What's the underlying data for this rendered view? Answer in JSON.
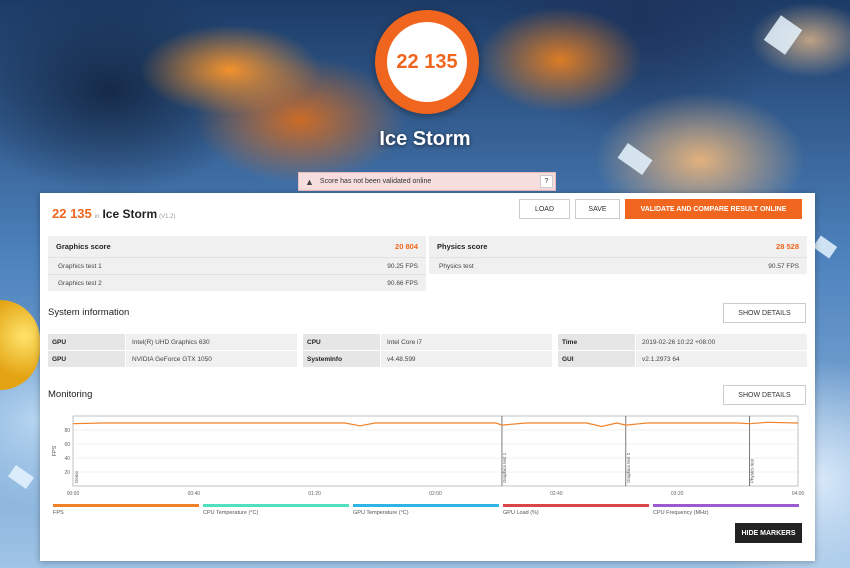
{
  "score": "22 135",
  "test_name": "Ice Storm",
  "warning": {
    "text": "Score has not been validated online",
    "help": "?"
  },
  "header": {
    "score": "22 135",
    "in": "in",
    "test_name": "Ice Storm",
    "version": "(V1.2)"
  },
  "buttons": {
    "load": "LOAD",
    "save": "SAVE",
    "validate": "VALIDATE AND COMPARE RESULT ONLINE",
    "show_details_system": "SHOW DETAILS",
    "show_details_monitoring": "SHOW DETAILS",
    "hide_markers": "HIDE MARKERS"
  },
  "graphics": {
    "label": "Graphics score",
    "value": "20 804",
    "tests": [
      {
        "name": "Graphics test 1",
        "value": "90.25 FPS"
      },
      {
        "name": "Graphics test 2",
        "value": "90.66 FPS"
      }
    ]
  },
  "physics": {
    "label": "Physics score",
    "value": "28 528",
    "tests": [
      {
        "name": "Physics test",
        "value": "90.57 FPS"
      }
    ]
  },
  "system_info": {
    "title": "System information",
    "groups": [
      [
        {
          "k": "GPU",
          "v": "Intel(R) UHD Graphics 630"
        },
        {
          "k": "GPU",
          "v": "NVIDIA GeForce GTX 1050"
        }
      ],
      [
        {
          "k": "CPU",
          "v": "Intel Core i7"
        },
        {
          "k": "SystemInfo",
          "v": "v4.48.599"
        }
      ],
      [
        {
          "k": "Time",
          "v": "2019-02-26 10:22 +08:00"
        },
        {
          "k": "GUI",
          "v": "v2.1.2973 64"
        }
      ]
    ]
  },
  "monitoring": {
    "title": "Monitoring",
    "ylabel": "FPS",
    "legend": [
      {
        "label": "FPS",
        "color": "#f0822a"
      },
      {
        "label": "CPU Temperature (°C)",
        "color": "#4fe0c0"
      },
      {
        "label": "GPU Temperature (°C)",
        "color": "#2fb4e6"
      },
      {
        "label": "GPU Load (%)",
        "color": "#d9454a"
      },
      {
        "label": "CPU Frequency (MHz)",
        "color": "#9a5ad0"
      }
    ]
  },
  "chart_data": {
    "type": "line",
    "ylabel": "FPS",
    "ylim": [
      0,
      100
    ],
    "yticks": [
      20,
      40,
      60,
      80
    ],
    "x_ticks": [
      "00:00",
      "00:40",
      "01:20",
      "02:00",
      "02:40",
      "03:20",
      "04:00"
    ],
    "x_range_seconds": [
      0,
      240
    ],
    "markers": [
      {
        "label": "Demo",
        "t": 0
      },
      {
        "label": "Graphics test 1",
        "t": 142
      },
      {
        "label": "Graphics test 2",
        "t": 183
      },
      {
        "label": "Physics test",
        "t": 224
      }
    ],
    "series": [
      {
        "name": "FPS",
        "color": "#f0822a",
        "x": [
          0,
          10,
          20,
          30,
          40,
          50,
          60,
          70,
          80,
          90,
          95,
          100,
          110,
          120,
          130,
          140,
          142,
          150,
          160,
          170,
          175,
          180,
          183,
          190,
          200,
          210,
          220,
          224,
          230,
          240
        ],
        "y": [
          89,
          90,
          90,
          90,
          90,
          90,
          90,
          90,
          90,
          90,
          86,
          90,
          90,
          90,
          90,
          90,
          87,
          90,
          90,
          90,
          85,
          90,
          87,
          90,
          90,
          90,
          90,
          89,
          91,
          90
        ]
      }
    ],
    "grid": true
  }
}
